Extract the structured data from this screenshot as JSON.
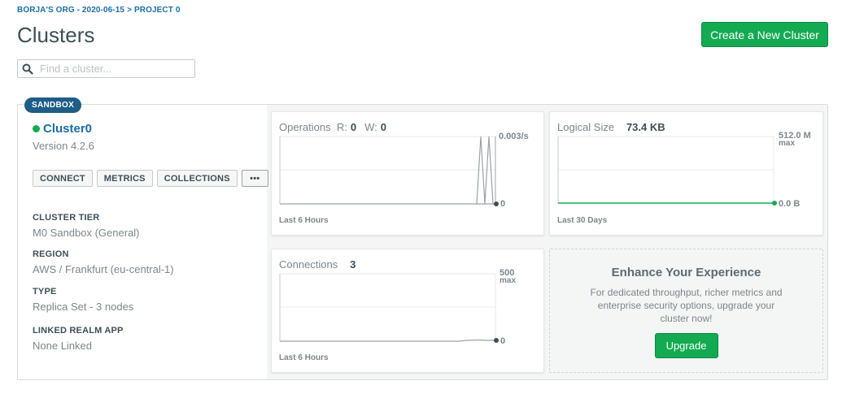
{
  "breadcrumb": {
    "org": "BORJA'S ORG - 2020-06-15",
    "separator": ">",
    "project": "PROJECT 0"
  },
  "page": {
    "title": "Clusters",
    "create_button": "Create a New Cluster"
  },
  "search": {
    "placeholder": "Find a cluster...",
    "value": ""
  },
  "cluster": {
    "badge": "SANDBOX",
    "name": "Cluster0",
    "version": "Version 4.2.6",
    "status_color": "#13aa52",
    "buttons": {
      "connect": "CONNECT",
      "metrics": "METRICS",
      "collections": "COLLECTIONS",
      "more": "•••"
    },
    "info": [
      {
        "label": "CLUSTER TIER",
        "value": "M0 Sandbox (General)"
      },
      {
        "label": "REGION",
        "value": "AWS / Frankfurt (eu-central-1)"
      },
      {
        "label": "TYPE",
        "value": "Replica Set - 3 nodes"
      },
      {
        "label": "LINKED REALM APP",
        "value": "None Linked"
      }
    ]
  },
  "metrics": {
    "operations": {
      "title": "Operations",
      "r_label": "R:",
      "r_value": "0",
      "w_label": "W:",
      "w_value": "0",
      "max_label": "0.003/s",
      "min_label": "0",
      "footer": "Last 6 Hours"
    },
    "logical_size": {
      "title": "Logical Size",
      "value": "73.4 KB",
      "max_label": "512.0 M",
      "max_sub": "max",
      "min_label": "0.0 B",
      "footer": "Last 30 Days"
    },
    "connections": {
      "title": "Connections",
      "value": "3",
      "max_label": "500",
      "max_sub": "max",
      "min_label": "0",
      "footer": "Last 6 Hours"
    }
  },
  "enhance": {
    "title": "Enhance Your Experience",
    "description": "For dedicated throughput, richer metrics and enterprise security options, upgrade your cluster now!",
    "button": "Upgrade"
  },
  "colors": {
    "accent_green": "#13aa52",
    "link_blue": "#1a6fa6",
    "badge_blue": "#1f5d87"
  }
}
